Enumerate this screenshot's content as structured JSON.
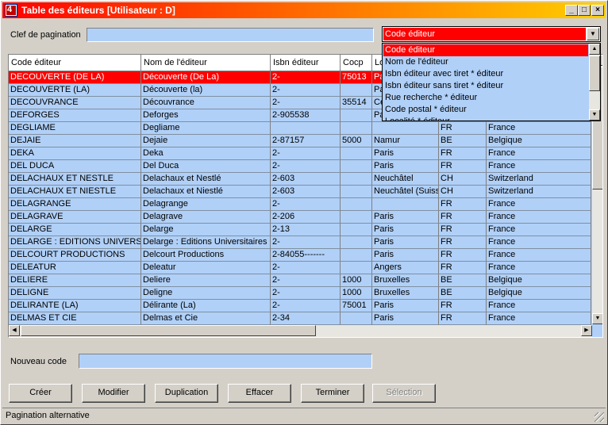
{
  "window": {
    "title": "Table des éditeurs [Utilisateur : D]",
    "app_icon": "4",
    "controls": {
      "minimize": "_",
      "maximize": "□",
      "close": "×"
    }
  },
  "pagination": {
    "label": "Clef de pagination",
    "value": "",
    "combo_value": "Code éditeur",
    "options": [
      "Code éditeur",
      "Nom de l'éditeur",
      "Isbn éditeur avec tiret * éditeur",
      "Isbn éditeur sans tiret * éditeur",
      "Rue recherche * éditeur",
      "Code postal * éditeur",
      "Localité * éditeur"
    ]
  },
  "table": {
    "columns": [
      "Code éditeur",
      "Nom de l'éditeur",
      "Isbn éditeur",
      "Cocp",
      "Lo",
      "",
      ""
    ],
    "rows": [
      [
        "DECOUVERTE (DE LA)",
        "Découverte (De La)",
        "2-",
        "75013",
        "Pa",
        "",
        ""
      ],
      [
        "DECOUVERTE (LA)",
        "Découverte (la)",
        "2-",
        "",
        "Pa",
        "",
        ""
      ],
      [
        "DECOUVRANCE",
        "Découvrance",
        "2-",
        "35514",
        "Ce",
        "",
        ""
      ],
      [
        "DEFORGES",
        "Deforges",
        "2-905538",
        "",
        "Pa",
        "",
        ""
      ],
      [
        "DEGLIAME",
        "Degliame",
        "",
        "",
        "",
        "FR",
        "France"
      ],
      [
        "DEJAIE",
        "Dejaie",
        "2-87157",
        "5000",
        "Namur",
        "BE",
        "Belgique"
      ],
      [
        "DEKA",
        "Deka",
        "2-",
        "",
        "Paris",
        "FR",
        "France"
      ],
      [
        "DEL DUCA",
        "Del Duca",
        "2-",
        "",
        "Paris",
        "FR",
        "France"
      ],
      [
        "DELACHAUX ET NESTLE",
        "Delachaux et Nestlé",
        "2-603",
        "",
        "Neuchâtel",
        "CH",
        "Switzerland"
      ],
      [
        "DELACHAUX ET NIESTLE",
        "Delachaux et Niestlé",
        "2-603",
        "",
        "Neuchâtel (Suiss",
        "CH",
        "Switzerland"
      ],
      [
        "DELAGRANGE",
        "Delagrange",
        "2-",
        "",
        "",
        "FR",
        "France"
      ],
      [
        "DELAGRAVE",
        "Delagrave",
        "2-206",
        "",
        "Paris",
        "FR",
        "France"
      ],
      [
        "DELARGE",
        "Delarge",
        "2-13",
        "",
        "Paris",
        "FR",
        "France"
      ],
      [
        "DELARGE : EDITIONS UNIVERS",
        "Delarge : Editions Universitaires",
        "2-",
        "",
        "Paris",
        "FR",
        "France"
      ],
      [
        "DELCOURT PRODUCTIONS",
        "Delcourt Productions",
        "2-84055-------",
        "",
        "Paris",
        "FR",
        "France"
      ],
      [
        "DELEATUR",
        "Deleatur",
        "2-",
        "",
        "Angers",
        "FR",
        "France"
      ],
      [
        "DELIERE",
        "Deliere",
        "2-",
        "1000",
        "Bruxelles",
        "BE",
        "Belgique"
      ],
      [
        "DELIGNE",
        "Deligne",
        "2-",
        "1000",
        "Bruxelles",
        "BE",
        "Belgique"
      ],
      [
        "DELIRANTE (LA)",
        "Délirante (La)",
        "2-",
        "75001",
        "Paris",
        "FR",
        "France"
      ],
      [
        "DELMAS ET CIE",
        "Delmas et Cie",
        "2-34",
        "",
        "Paris",
        "FR",
        "France"
      ],
      [
        "",
        "",
        "",
        "",
        "",
        "",
        ""
      ]
    ]
  },
  "new_code": {
    "label": "Nouveau code",
    "value": ""
  },
  "buttons": {
    "create": "Créer",
    "modify": "Modifier",
    "duplicate": "Duplication",
    "delete": "Effacer",
    "finish": "Terminer",
    "selection": "Sélection"
  },
  "status": "Pagination alternative",
  "colors": {
    "selection": "#ff0000",
    "field": "#b0d0f8",
    "face": "#d4d0c8"
  }
}
